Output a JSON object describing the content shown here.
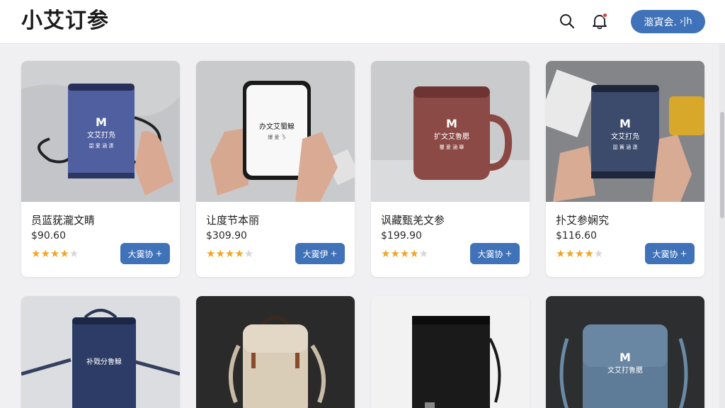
{
  "header": {
    "brand": "小艾订参",
    "account_label": "㴴寊会.",
    "account_arrow": "›|h"
  },
  "products": [
    {
      "title": "员蓝莸瀧文睛",
      "price": "$90.60",
      "add_label": "大霙协",
      "rating": 4.5,
      "image_logo": "M",
      "image_text": "文艾打凫",
      "image_sub": "㗊 爱 涵 潇"
    },
    {
      "title": "让度节本丽",
      "price": "$309.90",
      "add_label": "大霙伊",
      "rating": 4.5,
      "image_logo": "",
      "image_text": "办文艾蜀鰁",
      "image_sub": "爆 爱 ㄋ"
    },
    {
      "title": "讽藏甄羌文参",
      "price": "$199.90",
      "add_label": "大霙协",
      "rating": 4,
      "image_logo": "M",
      "image_text": "扩文艾鲁腮",
      "image_sub": "璽 爱 涵 舉"
    },
    {
      "title": "扑艾参娴究",
      "price": "$116.60",
      "add_label": "大霙协",
      "rating": 4.5,
      "image_logo": "M",
      "image_text": "文艾打凫",
      "image_sub": "㗊 簧 涵 潇"
    },
    {
      "image_logo": "",
      "image_text": "补戣分鲁鰁",
      "image_sub": ""
    },
    {
      "image_logo": "",
      "image_text": "",
      "image_sub": ""
    },
    {
      "image_logo": "",
      "image_text": "",
      "image_sub": ""
    },
    {
      "image_logo": "M",
      "image_text": "文艾打鲁腮",
      "image_sub": ""
    }
  ],
  "colors": {
    "accent": "#3f72b8",
    "star": "#f0a524",
    "badge": "#e23b3b"
  },
  "icons": {
    "search": "search-icon",
    "bell": "bell-icon",
    "arrow": "arrow-right-icon"
  }
}
